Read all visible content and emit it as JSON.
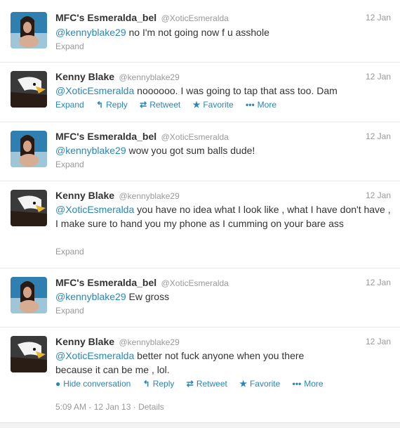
{
  "tweets": [
    {
      "avatar": "woman-avatar",
      "name": "MFC's Esmeralda_bel",
      "handle": "@XoticEsmeralda",
      "time": "12 Jan",
      "mention": "@kennyblake29",
      "text": " no I'm not going now f u asshole",
      "expand": "Expand"
    },
    {
      "avatar": "eagle-avatar",
      "name": "Kenny Blake",
      "handle": "@kennyblake29",
      "time": "12 Jan",
      "mention": "@XoticEsmeralda",
      "text": " noooooo. I was going to tap that ass too. Dam",
      "expand": "Expand",
      "reply": "Reply",
      "retweet": "Retweet",
      "favorite": "Favorite",
      "more": "More"
    },
    {
      "avatar": "woman-avatar",
      "name": "MFC's Esmeralda_bel",
      "handle": "@XoticEsmeralda",
      "time": "12 Jan",
      "mention": "@kennyblake29",
      "text": " wow you got sum balls dude!",
      "expand": "Expand"
    },
    {
      "avatar": "eagle-avatar",
      "name": "Kenny Blake",
      "handle": "@kennyblake29",
      "time": "12 Jan",
      "mention": "@XoticEsmeralda",
      "text": " you have no idea what I look like , what I have don't have , I make sure to hand you my phone as I cumming on your bare ass",
      "expand": "Expand"
    },
    {
      "avatar": "woman-avatar",
      "name": "MFC's Esmeralda_bel",
      "handle": "@XoticEsmeralda",
      "time": "12 Jan",
      "mention": "@kennyblake29",
      "text": " Ew gross",
      "expand": "Expand"
    },
    {
      "avatar": "eagle-avatar",
      "name": "Kenny Blake",
      "handle": "@kennyblake29",
      "time": "12 Jan",
      "mention": "@XoticEsmeralda",
      "text": " better not fuck anyone when you there because it can be me , lol.",
      "hide": "Hide conversation",
      "reply": "Reply",
      "retweet": "Retweet",
      "favorite": "Favorite",
      "more": "More",
      "timestamp": "5:09 AM - 12 Jan 13",
      "details": "Details"
    }
  ],
  "colors": {
    "link": "#2a86b5",
    "muted": "#999999",
    "text": "#333333"
  }
}
